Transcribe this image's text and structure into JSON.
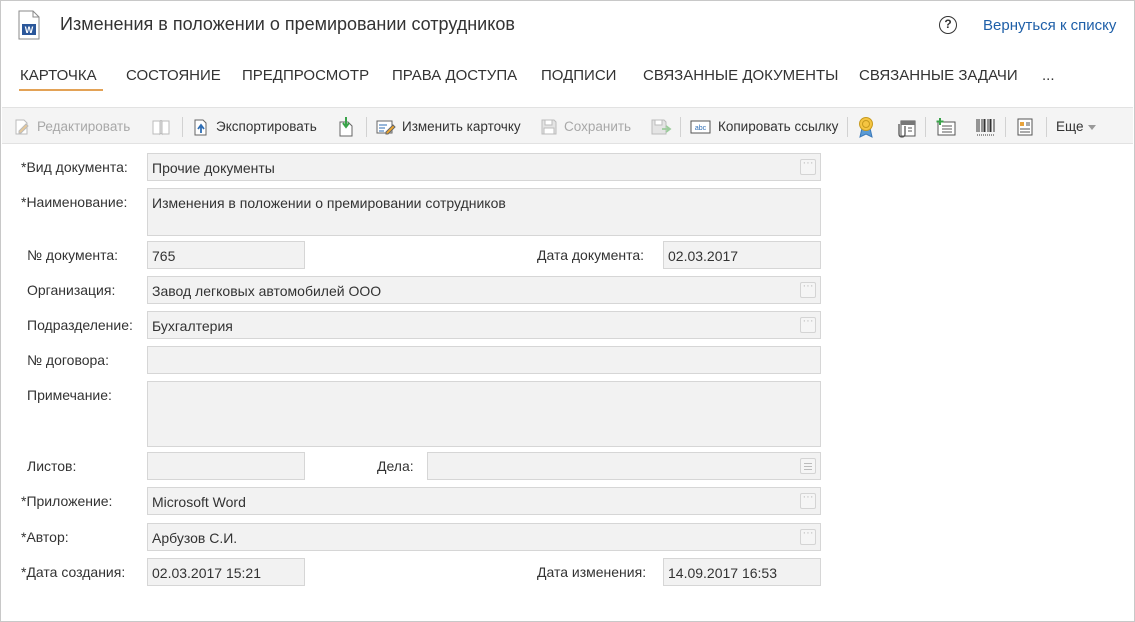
{
  "header": {
    "title": "Изменения в положении о премировании сотрудников",
    "doc_icon_letter": "W",
    "help_symbol": "?",
    "back_link": "Вернуться к списку"
  },
  "tabs": [
    {
      "label": "КАРТОЧКА",
      "active": true
    },
    {
      "label": "СОСТОЯНИЕ"
    },
    {
      "label": "ПРЕДПРОСМОТР"
    },
    {
      "label": "ПРАВА ДОСТУПА"
    },
    {
      "label": "ПОДПИСИ"
    },
    {
      "label": "СВЯЗАННЫЕ ДОКУМЕНТЫ"
    },
    {
      "label": "СВЯЗАННЫЕ ЗАДАЧИ"
    },
    {
      "label": "..."
    }
  ],
  "toolbar": {
    "edit": "Редактировать",
    "export": "Экспортировать",
    "change_card": "Изменить карточку",
    "save": "Сохранить",
    "copy_link": "Копировать ссылку",
    "more": "Еще",
    "copy_link_icon_text": "abc"
  },
  "form": {
    "doc_type": {
      "label": "*Вид документа:",
      "value": "Прочие документы"
    },
    "name": {
      "label": "*Наименование:",
      "value": "Изменения в положении о премировании сотрудников"
    },
    "doc_number": {
      "label": "№ документа:",
      "value": "765"
    },
    "doc_date": {
      "label": "Дата документа:",
      "value": "02.03.2017"
    },
    "organization": {
      "label": "Организация:",
      "value": "Завод легковых автомобилей ООО"
    },
    "department": {
      "label": "Подразделение:",
      "value": "Бухгалтерия"
    },
    "contract_number": {
      "label": "№ договора:",
      "value": ""
    },
    "note": {
      "label": "Примечание:",
      "value": ""
    },
    "sheets": {
      "label": "Листов:",
      "value": ""
    },
    "cases": {
      "label": "Дела:",
      "value": ""
    },
    "application": {
      "label": "*Приложение:",
      "value": "Microsoft Word"
    },
    "author": {
      "label": "*Автор:",
      "value": "Арбузов С.И."
    },
    "created": {
      "label": "*Дата создания:",
      "value": "02.03.2017 15:21"
    },
    "modified": {
      "label": "Дата изменения:",
      "value": "14.09.2017 16:53"
    }
  },
  "colors": {
    "accent": "#e3a256",
    "link": "#1e5fa8",
    "field_bg": "#f2f2f2",
    "toolbar_bg": "#f4f4f4"
  }
}
